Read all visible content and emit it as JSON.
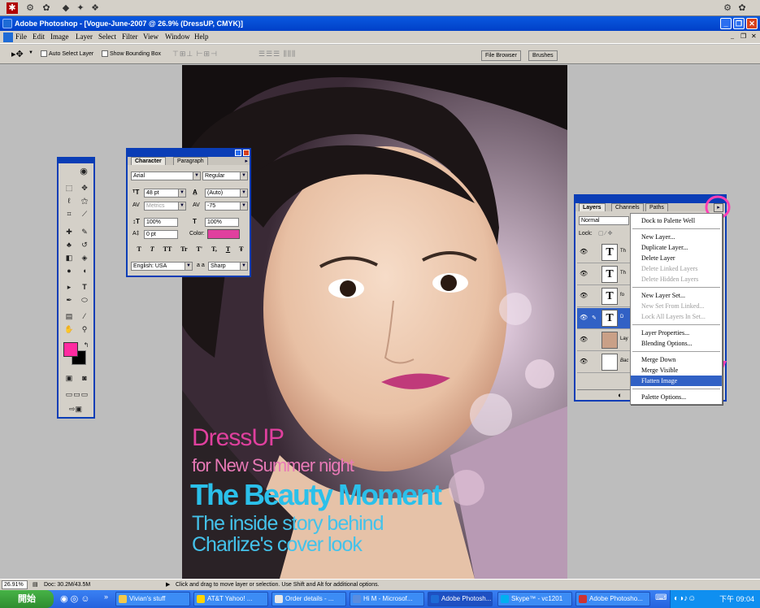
{
  "app_title": "Adobe Photoshop - [Vogue-June-2007 @ 26.9% (DressUP, CMYK)]",
  "menu": [
    "File",
    "Edit",
    "Image",
    "Layer",
    "Select",
    "Filter",
    "View",
    "Window",
    "Help"
  ],
  "options": {
    "auto_select": "Auto Select Layer",
    "bounding_box": "Show Bounding Box"
  },
  "well_tabs": [
    "File Browser",
    "Brushes"
  ],
  "character_panel": {
    "tabs": [
      "Character",
      "Paragraph"
    ],
    "font_family": "Arial",
    "font_style": "Regular",
    "size": "48 pt",
    "leading": "(Auto)",
    "kerning": "Metrics",
    "tracking": "-75",
    "vscale": "100%",
    "hscale": "100%",
    "baseline": "0 pt",
    "color_label": "Color:",
    "color": "#e0409e",
    "language": "English: USA",
    "aa_label": "a a",
    "antialias": "Sharp",
    "style_buttons": [
      "T",
      "T",
      "TT",
      "Tr",
      "T'",
      "T,",
      "T",
      "Ŧ"
    ]
  },
  "layers_panel": {
    "tabs": [
      "Layers",
      "Channels",
      "Paths"
    ],
    "blend_mode": "Normal",
    "lock_label": "Lock:",
    "layers": [
      {
        "thumb": "T",
        "name": "Th"
      },
      {
        "thumb": "T",
        "name": "Th"
      },
      {
        "thumb": "T",
        "name": "fo"
      },
      {
        "thumb": "T",
        "name": "D"
      },
      {
        "thumb": "",
        "name": "Lay"
      },
      {
        "thumb": "",
        "name": "Bac"
      }
    ]
  },
  "context_menu": [
    {
      "label": "Dock to Palette Well",
      "state": "normal"
    },
    {
      "sep": true
    },
    {
      "label": "New Layer...",
      "state": "normal"
    },
    {
      "label": "Duplicate Layer...",
      "state": "normal"
    },
    {
      "label": "Delete Layer",
      "state": "normal"
    },
    {
      "label": "Delete Linked Layers",
      "state": "disabled"
    },
    {
      "label": "Delete Hidden Layers",
      "state": "disabled"
    },
    {
      "sep": true
    },
    {
      "label": "New Layer Set...",
      "state": "normal"
    },
    {
      "label": "New Set From Linked...",
      "state": "disabled"
    },
    {
      "label": "Lock All Layers In Set...",
      "state": "disabled"
    },
    {
      "sep": true
    },
    {
      "label": "Layer Properties...",
      "state": "normal"
    },
    {
      "label": "Blending Options...",
      "state": "normal"
    },
    {
      "sep": true
    },
    {
      "label": "Merge Down",
      "state": "normal"
    },
    {
      "label": "Merge Visible",
      "state": "normal"
    },
    {
      "label": "Flatten Image",
      "state": "highlighted"
    },
    {
      "sep": true
    },
    {
      "label": "Palette Options...",
      "state": "normal"
    }
  ],
  "cover_text": {
    "line1": "DressUP",
    "line2": "for New Summer night",
    "line3": "The Beauty Moment",
    "line4": "The inside story behind",
    "line5": "Charlize's cover look"
  },
  "colors": {
    "foreground": "#ff2aa0",
    "background": "#000000",
    "annotation": "#ff3fb4",
    "menu_highlight": "#3161c5"
  },
  "status": {
    "zoom": "26.91%",
    "doc": "Doc: 30.2M/43.5M",
    "hint": "Click and drag to move layer or selection.  Use Shift and Alt for additional options."
  },
  "taskbar": {
    "start": "開始",
    "items": [
      "Vivian's stuff",
      "AT&T Yahoo! ...",
      "Order details - ...",
      "Hi M - Microsof...",
      "Adobe Photosh...",
      "Skype™ - vc1201",
      "Adobe Photosho..."
    ],
    "clock": "下午 09:04"
  }
}
